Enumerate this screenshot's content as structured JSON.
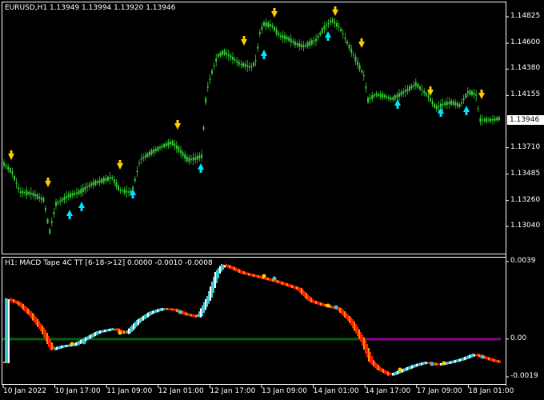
{
  "main_chart": {
    "symbol_info": "EURUSD,H1  1.13949 1.13994 1.13920 1.13946",
    "current_price": "1.13946",
    "price_levels": [
      {
        "label": "1.14825",
        "value": 1.14825
      },
      {
        "label": "1.14600",
        "value": 1.146
      },
      {
        "label": "1.14380",
        "value": 1.1438
      },
      {
        "label": "1.14155",
        "value": 1.14155
      },
      {
        "label": "1.13710",
        "value": 1.1371
      },
      {
        "label": "1.13485",
        "value": 1.13485
      },
      {
        "label": "1.13260",
        "value": 1.1326
      },
      {
        "label": "1.13040",
        "value": 1.1304
      }
    ],
    "colors": {
      "candle": "#32cd32",
      "sell_arrow": "#ffcc00",
      "buy_arrow": "#00e5ff",
      "background": "#000000",
      "frame": "#ffffff"
    }
  },
  "indicator": {
    "title": "H1: MACD Tape 4C TT [6-18->12] 0.0000 -0.0010 -0.0008",
    "levels": [
      {
        "label": "0.0039",
        "value": 0.0039
      },
      {
        "label": "0.00",
        "value": 0.0
      },
      {
        "label": "-0.0019",
        "value": -0.0019
      }
    ],
    "colors": {
      "up_strong": "#3cc8d2",
      "up_weak": "#ffffff",
      "down_strong": "#ff1a00",
      "down_weak": "#ff8c00",
      "zero_line": "#006400",
      "signal": "#8b008b"
    }
  },
  "time_axis": [
    "10 Jan 2022",
    "10 Jan 17:00",
    "11 Jan 09:00",
    "12 Jan 01:00",
    "12 Jan 17:00",
    "13 Jan 09:00",
    "14 Jan 01:00",
    "14 Jan 17:00",
    "17 Jan 09:00",
    "18 Jan 01:00"
  ]
}
